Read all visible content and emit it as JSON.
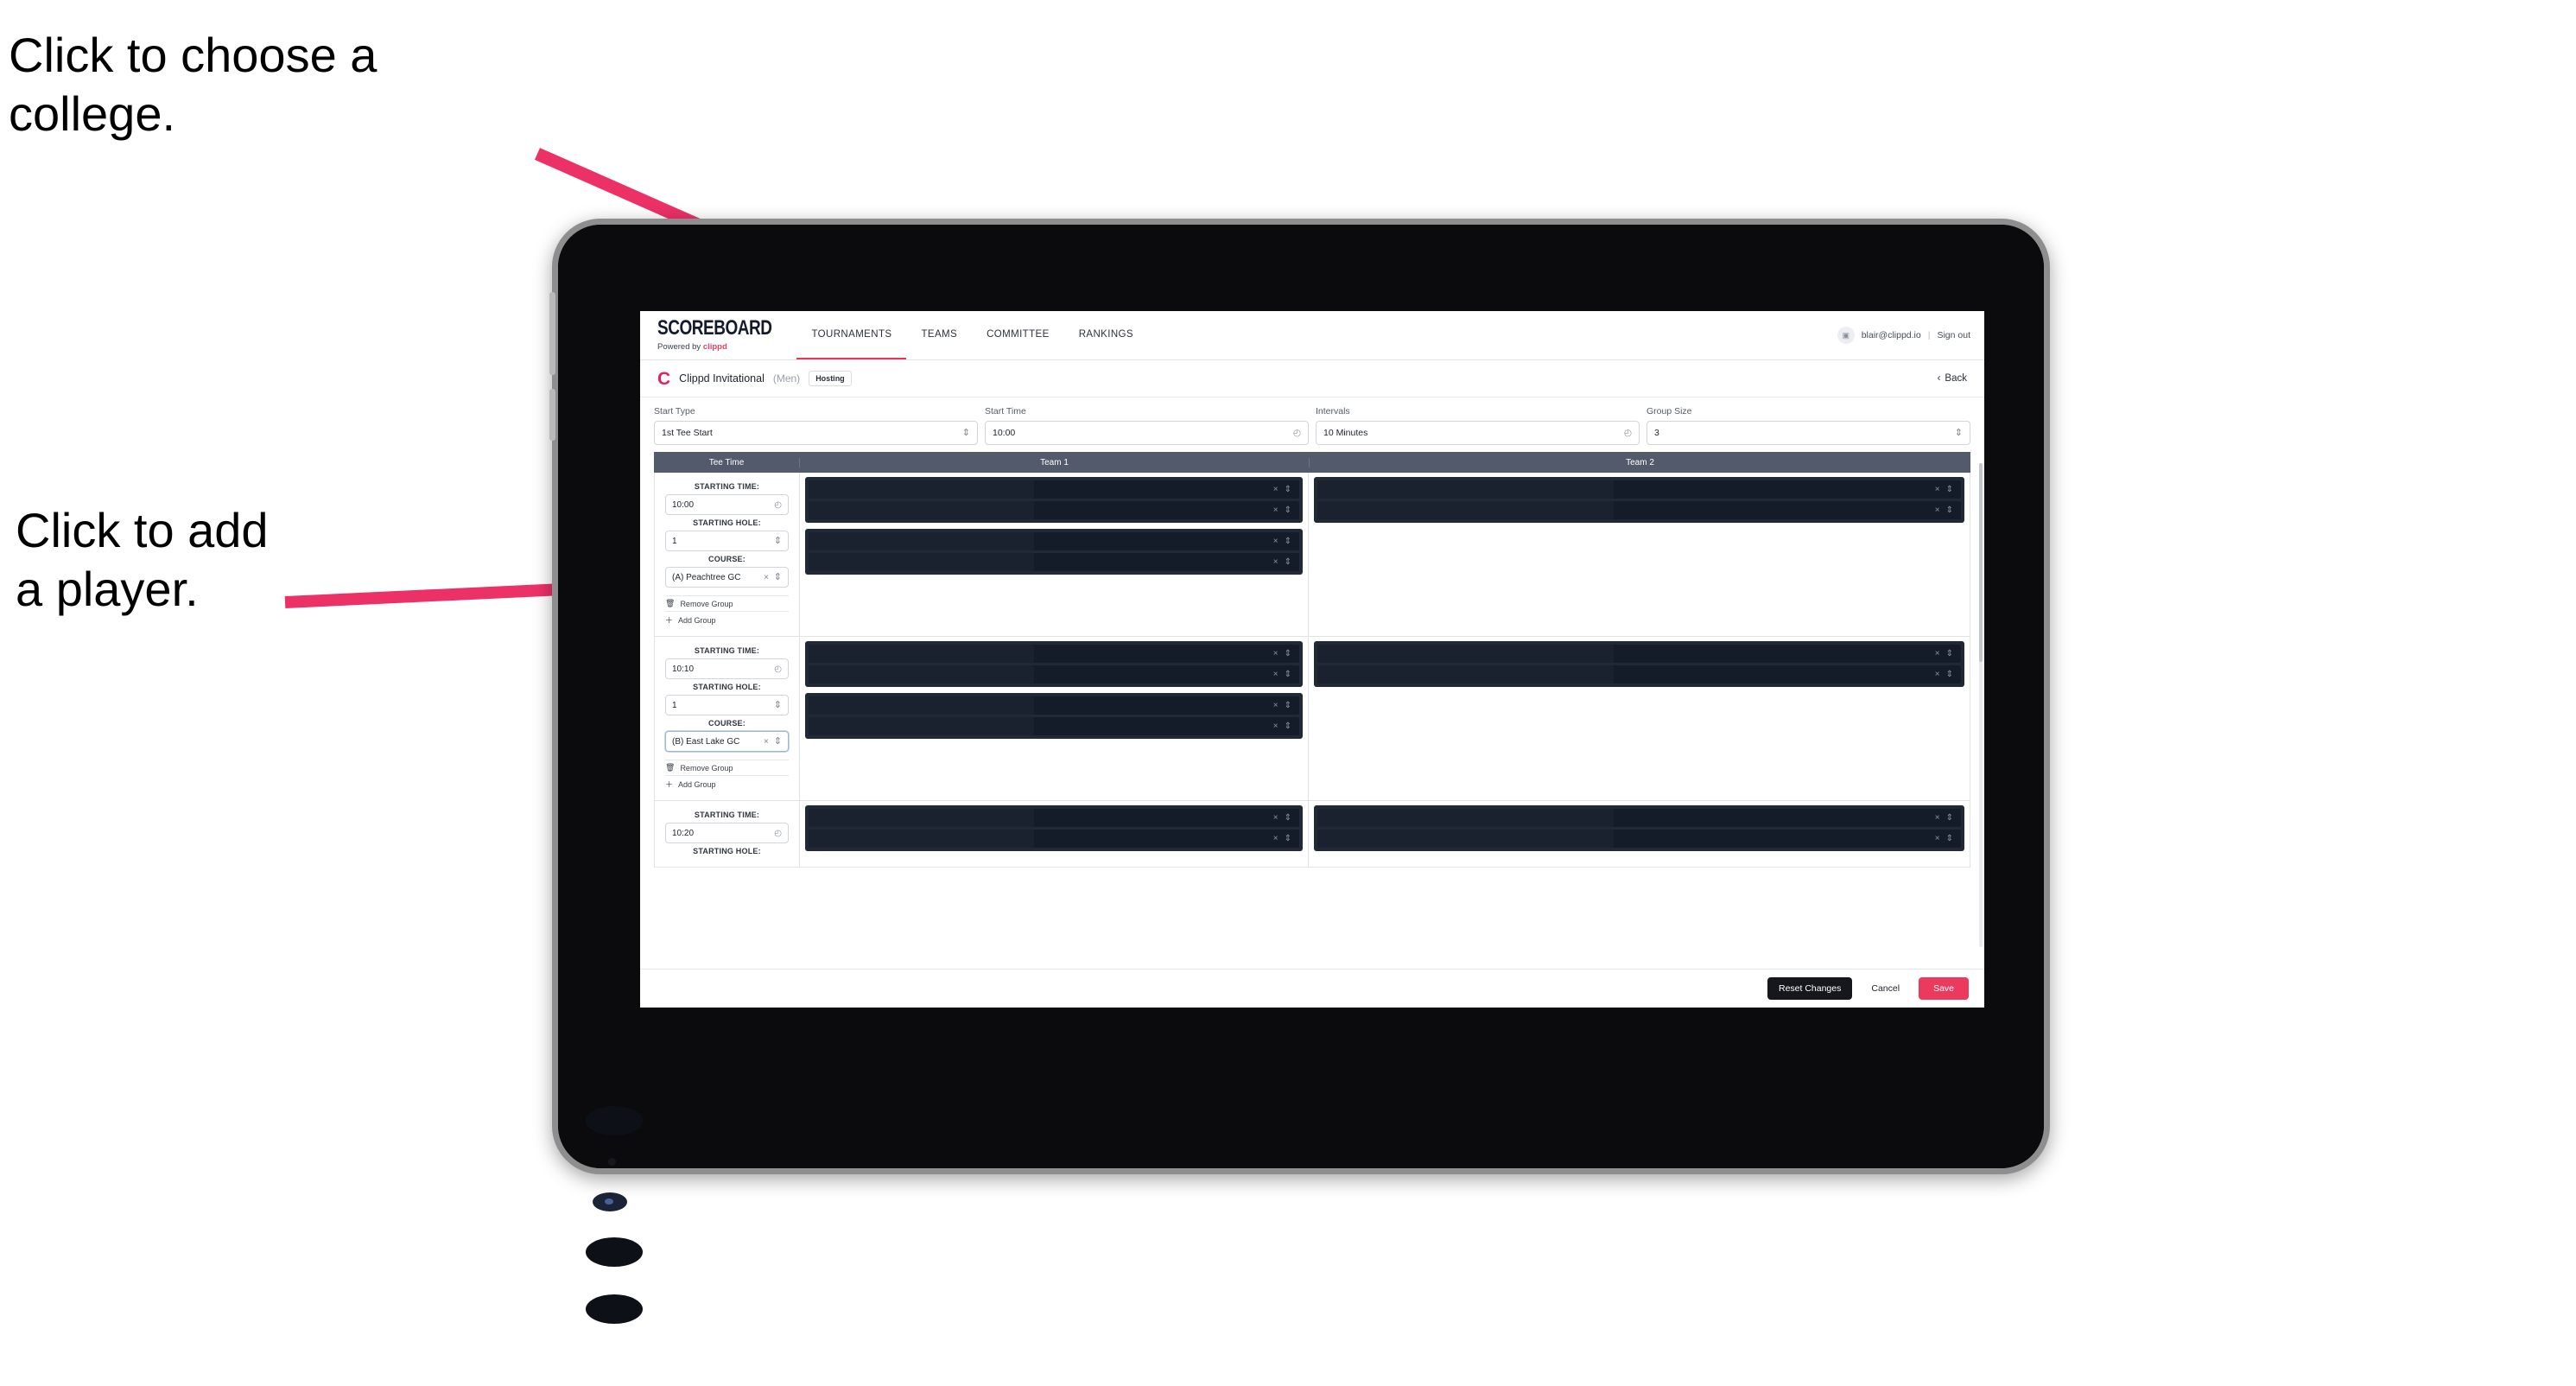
{
  "annotations": [
    {
      "id": "choose-college",
      "text": "Click to choose a\ncollege."
    },
    {
      "id": "add-player",
      "text": "Click to add\na player."
    }
  ],
  "colors": {
    "accent_pink": "#ec3a5f",
    "brand_red": "#e0245e",
    "table_header": "#535a6b",
    "player_panel": "#212936",
    "player_row": "#151c29",
    "arrow": "#ec3167"
  },
  "app": {
    "brand": {
      "wordmark": "SCOREBOARD",
      "powered_prefix": "Powered by ",
      "powered_by": "clippd"
    },
    "nav_tabs": [
      {
        "label": "TOURNAMENTS",
        "active": true
      },
      {
        "label": "TEAMS",
        "active": false
      },
      {
        "label": "COMMITTEE",
        "active": false
      },
      {
        "label": "RANKINGS",
        "active": false
      }
    ],
    "account": {
      "avatar_glyph": "▣",
      "email": "blair@clippd.io",
      "separator": "|",
      "sign_out": "Sign out"
    },
    "tournament": {
      "logo_letter": "C",
      "name": "Clippd Invitational",
      "gender": "(Men)",
      "badge": "Hosting",
      "back_label": "Back",
      "back_icon": "‹"
    },
    "settings": [
      {
        "label": "Start Type",
        "value": "1st Tee Start",
        "control": "select",
        "icon": "spinner"
      },
      {
        "label": "Start Time",
        "value": "10:00",
        "control": "time",
        "icon": "clock"
      },
      {
        "label": "Intervals",
        "value": "10 Minutes",
        "control": "time",
        "icon": "clock"
      },
      {
        "label": "Group Size",
        "value": "3",
        "control": "select",
        "icon": "spinner"
      }
    ],
    "table": {
      "headers": [
        "Tee Time",
        "Team 1",
        "Team 2"
      ],
      "field_labels": {
        "time": "STARTING TIME:",
        "hole": "STARTING HOLE:",
        "course": "COURSE:"
      },
      "group_actions": {
        "remove": "Remove Group",
        "add": "Add Group",
        "remove_icon": "trash-icon",
        "add_icon": "plus-icon"
      },
      "rows": [
        {
          "starting_time": "10:00",
          "starting_hole": "1",
          "course": "(A) Peachtree GC",
          "course_focused": false,
          "team1_panels": 2,
          "team2_panels": 1
        },
        {
          "starting_time": "10:10",
          "starting_hole": "1",
          "course": "(B) East Lake GC",
          "course_focused": true,
          "team1_panels": 2,
          "team2_panels": 1
        },
        {
          "starting_time": "10:20",
          "starting_hole": "",
          "course": "",
          "course_focused": false,
          "team1_panels": 1,
          "team2_panels": 1,
          "clipped": true
        }
      ],
      "row_clear_glyph": "×",
      "row_spinner_glyph": "⇅"
    },
    "footer": {
      "reset_label": "Reset Changes",
      "cancel_label": "Cancel",
      "save_label": "Save"
    }
  }
}
